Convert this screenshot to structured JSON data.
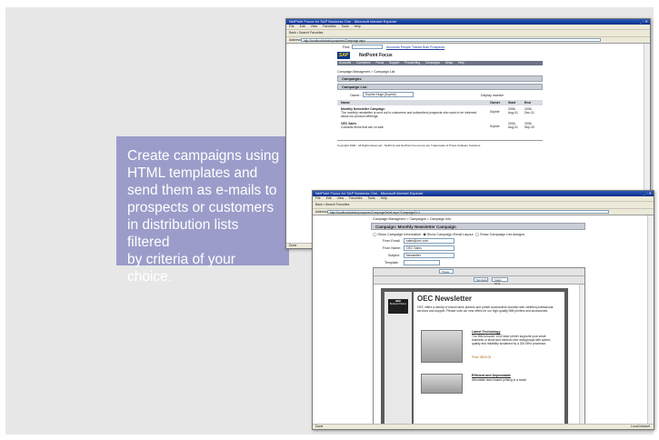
{
  "callout": {
    "lines": [
      "Create campaigns using",
      "HTML templates and",
      "send them as e-mails to",
      "prospects or customers",
      "in distribution lists filtered",
      "by criteria of your choice."
    ]
  },
  "back_window": {
    "title": "NetPoint Focus for SAP Business One - Microsoft Internet Explorer",
    "menu": [
      "File",
      "Edit",
      "View",
      "Favorites",
      "Tools",
      "Help"
    ],
    "toolbar": "Back  •  Search  Favorites",
    "address_label": "Address",
    "address": "http://localhost/admin/prospects/Campaign.aspx",
    "find_label": "Find:",
    "find_links": "Accounts People Tickets Bulk Prospects",
    "app_title": "NetPoint Focus",
    "logo": "SAP",
    "nav": [
      "Accounts",
      "Commerce",
      "Focus",
      "Support",
      "Prospecting",
      "Campaigns",
      "Setup",
      "Help"
    ],
    "breadcrumb": "Campaign Managment > Campaign List",
    "sections": [
      "Campaigns",
      "Campaign List"
    ],
    "owner_label": "Owner:",
    "owner_value": "Sophie Kluge [Sophie]",
    "display_inactive": "Display Inactive",
    "columns": [
      "Name",
      "Owner",
      "Start",
      "End"
    ],
    "rows": [
      {
        "name": "Monthly Newsletter Campaign",
        "desc": "The monthly newsletter is sent out to customers and subscribed prospects who want to be informed about our product offerings.",
        "owner": "Sophie",
        "start": "2006-Aug-01",
        "end": "2006-Dec-31"
      },
      {
        "name": "OEC Sales",
        "desc": "Contains items that are on sale.",
        "owner": "Sophie",
        "start": "2006-Aug-01",
        "end": "2006-Sep-30"
      }
    ],
    "footer": "Copyright 2006 - All Rights Reserved - NetPoint and NetPoint Commerce are Trademarks of Praxis Software Solutions.",
    "status": "Done"
  },
  "front_window": {
    "title": "NetPoint Focus for SAP Business One - Microsoft Internet Explorer",
    "menu": [
      "File",
      "Edit",
      "View",
      "Favorites",
      "Tools",
      "Help"
    ],
    "toolbar": "Back  •  Search  Favorites",
    "address_label": "Address",
    "address": "http://localhost/admin/prospects/CampaignDetail.aspx?CampaignID=1",
    "breadcrumb": "Campaign Managment > Campaigns > Campaign Info",
    "section": "Campaign: Monthly Newsletter Campaign",
    "radios": [
      "Show Campaign Information",
      "Show Campaign Email Layout",
      "Show Campaign List Assigns"
    ],
    "from_email_label": "From Email:",
    "from_email": "sales@oec.com",
    "from_name_label": "From Name:",
    "from_name": "OEC Sales",
    "subject_label": "Subject:",
    "subject": "Newsletter",
    "template_label": "Template:",
    "font_select": "Times",
    "symbols_select": "Symbols",
    "insert_select": "Insert Html",
    "newsletter": {
      "logo": "IBM",
      "logo_sub": "Business Partner",
      "heading": "OEC Newsletter",
      "intro": "OEC offers a variety of brand name printers and printer accessories bundled with certified professional services and support. Please note our new offers for our high-quality IBM printers and accessories.",
      "item1_title": "Latest Technology",
      "item1_text": "The IBM Infoprint 1332 laser printer supports your small business or small and medium size workgroups with speed, quality and reliability sustained by a 300 MHz processor.",
      "item1_price": "Price: $600.00",
      "item2_title": "Efficient and Dependable",
      "item2_text": "Affordable laser-based printing in a small"
    },
    "status_left": "Done",
    "status_right": "Local intranet"
  }
}
